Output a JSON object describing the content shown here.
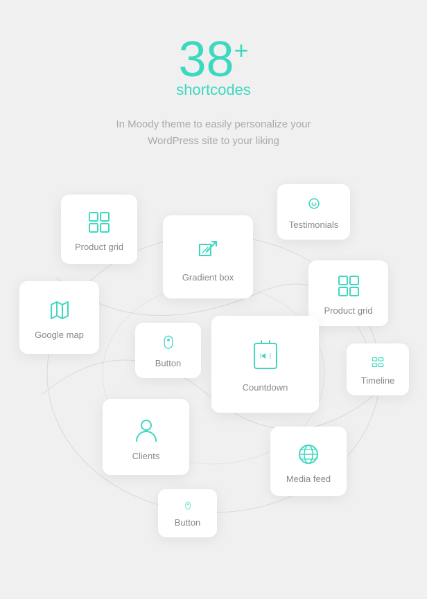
{
  "header": {
    "number": "38",
    "superscript": "+",
    "shortcodes": "shortcodes",
    "subtitle_line1": "In Moody theme to easily personalize your",
    "subtitle_line2": "WordPress site to your liking"
  },
  "cards": {
    "product_grid_1": {
      "label": "Product grid"
    },
    "gradient_box": {
      "label": "Gradient box"
    },
    "testimonials": {
      "label": "Testimonials"
    },
    "product_grid_2": {
      "label": "Product grid"
    },
    "google_map": {
      "label": "Google map"
    },
    "button_1": {
      "label": "Button"
    },
    "countdown": {
      "label": "Countdown"
    },
    "timeline": {
      "label": "Timeline"
    },
    "clients": {
      "label": "Clients"
    },
    "media_feed": {
      "label": "Media feed"
    },
    "button_2": {
      "label": "Button"
    }
  },
  "colors": {
    "accent": "#3dd8c0",
    "bg": "#f0f0f0",
    "card_bg": "#ffffff",
    "text_muted": "#aaaaaa",
    "label": "#999999"
  }
}
